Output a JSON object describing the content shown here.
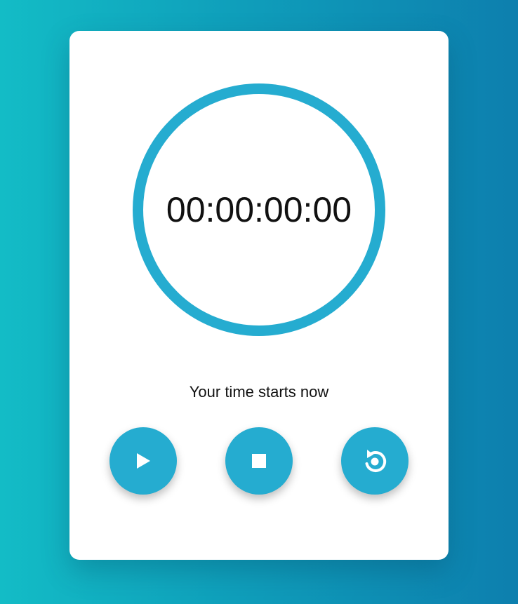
{
  "stopwatch": {
    "display": "00:00:00:00",
    "status": "Your time starts now"
  },
  "controls": {
    "play_icon": "play-icon",
    "stop_icon": "stop-icon",
    "reset_icon": "reset-icon"
  },
  "colors": {
    "accent": "#25acd0",
    "background_start": "#13bcc6",
    "background_end": "#0d7fae",
    "card": "#ffffff",
    "text": "#111111"
  }
}
